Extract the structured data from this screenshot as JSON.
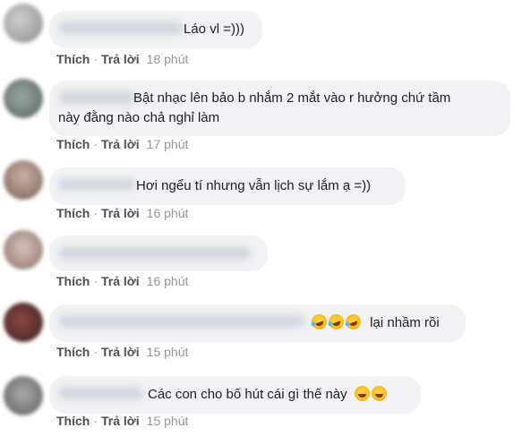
{
  "comments": [
    {
      "text": "Láo vl =)))",
      "like_label": "Thích",
      "reply_label": "Trả lời",
      "time": "18 phút",
      "emojis": []
    },
    {
      "text_line1": "Bật nhạc lên bảo b nhắm 2 mắt vào r hưởng chứ tầm",
      "text_line2": "này đằng nào chả nghỉ làm",
      "like_label": "Thích",
      "reply_label": "Trả lời",
      "time": "17 phút",
      "emojis": []
    },
    {
      "text": "Hơi ngểu tí nhưng vẫn lịch sự lắm ạ =))",
      "like_label": "Thích",
      "reply_label": "Trả lời",
      "time": "16 phút",
      "emojis": []
    },
    {
      "text": "",
      "like_label": "Thích",
      "reply_label": "Trả lời",
      "time": "16 phút",
      "emojis": []
    },
    {
      "text": "lại nhầm rồi",
      "like_label": "Thích",
      "reply_label": "Trả lời",
      "time": "15 phút",
      "emojis": [
        "rolling-laughing-emoji",
        "rolling-laughing-emoji",
        "rolling-laughing-emoji"
      ]
    },
    {
      "text": "Các con cho bố hút cái gì thế này",
      "like_label": "Thích",
      "reply_label": "Trả lời",
      "time": "15 phút",
      "emojis": [
        "grinning-emoji",
        "grinning-emoji"
      ]
    }
  ],
  "colors": {
    "bubble": "#f0f2f5",
    "action_text": "#606770",
    "text": "#1c1e21"
  }
}
